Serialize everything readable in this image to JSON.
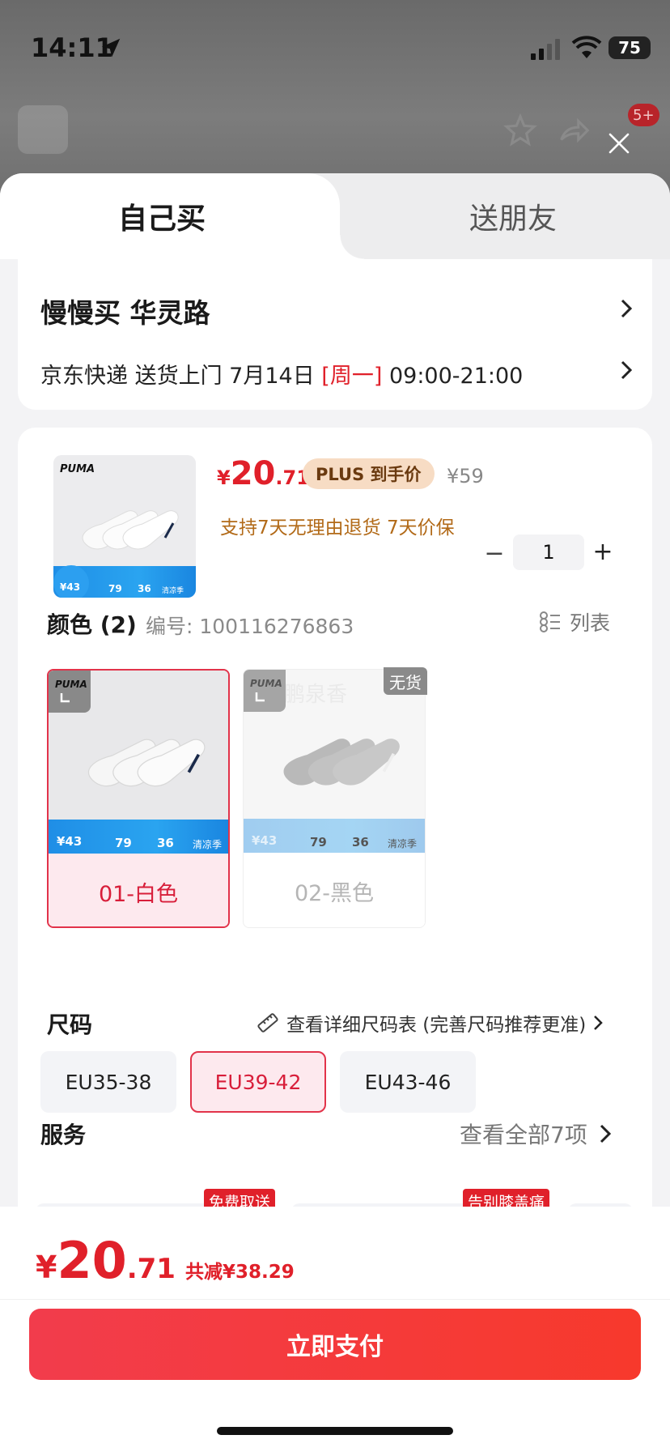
{
  "status_bar": {
    "time": "14:11",
    "battery": "75"
  },
  "background": {
    "badge": "5+"
  },
  "tabs": [
    {
      "label": "自己买",
      "active": true
    },
    {
      "label": "送朋友",
      "active": false
    }
  ],
  "address": {
    "name": "慢慢买  华灵路",
    "delivery_prefix": "京东快递 送货上门 7月14日 ",
    "delivery_day": "[周一]",
    "delivery_time": " 09:00-21:00"
  },
  "product": {
    "price_symbol": "¥",
    "price_int": "20",
    "price_dec": ".71",
    "plus_label": "PLUS 到手价",
    "original_price": "¥59",
    "services": "支持7天无理由退货   7天价保",
    "quantity": "1",
    "thumb_brand": "PUMA",
    "thumb_promo": {
      "left": "¥43",
      "mid": "79",
      "right": "36",
      "tag": "清凉季"
    }
  },
  "color": {
    "title": "颜色 (2)",
    "sku_label": "编号: 100116276863",
    "list_label": "列表",
    "options": [
      {
        "label": "01-白色",
        "selected": true,
        "available": true
      },
      {
        "label": "02-黑色",
        "selected": false,
        "available": false,
        "badge": "无货"
      }
    ],
    "watermark": "鹏泉香"
  },
  "size": {
    "title": "尺码",
    "chart_link": "查看详细尺码表 (完善尺码推荐更准)",
    "options": [
      {
        "label": "EU35-38",
        "selected": false
      },
      {
        "label": "EU39-42",
        "selected": true
      },
      {
        "label": "EU43-46",
        "selected": false
      }
    ]
  },
  "service": {
    "title": "服务",
    "view_all": "查看全部7项",
    "tags": [
      "免费取送",
      "告别膝盖痛"
    ]
  },
  "footer": {
    "price_symbol": "¥",
    "price_int": "20",
    "price_dec": ".71",
    "savings": "共减¥38.29",
    "pay_label": "立即支付"
  },
  "colors": {
    "accent": "#e0202a",
    "selected_bg": "#fde9ee",
    "plus_bg": "#f7dcc4"
  }
}
